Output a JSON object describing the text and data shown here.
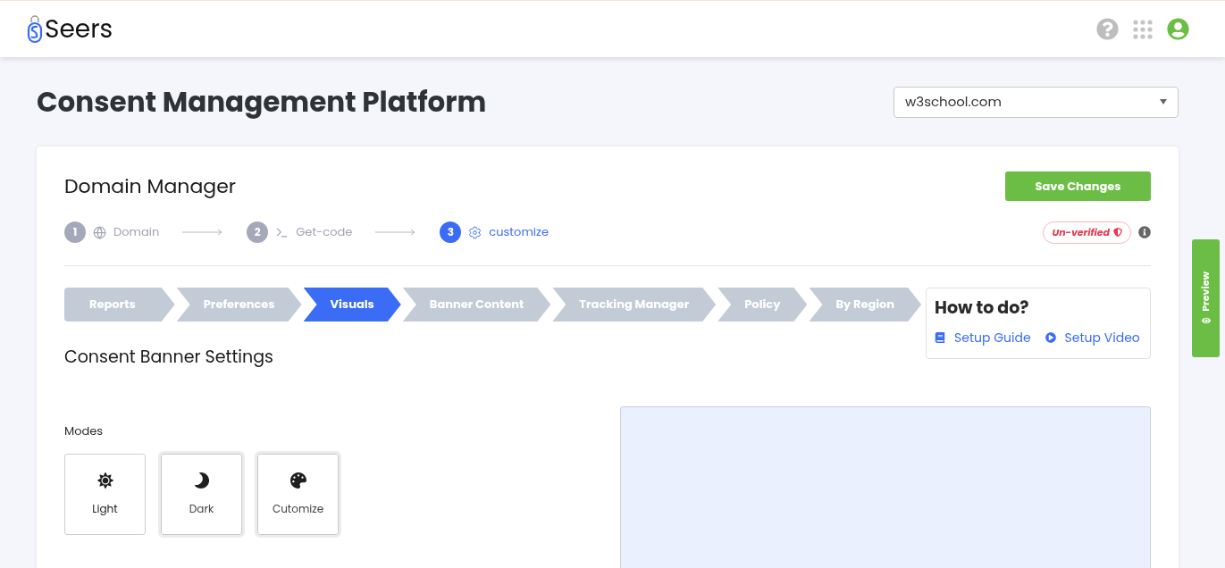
{
  "header": {
    "logo_text": "Seers"
  },
  "page_title": "Consent Management Platform",
  "domain_select": {
    "value": "w3school.com"
  },
  "card": {
    "title": "Domain Manager",
    "save_button": "Save Changes",
    "steps": [
      {
        "number": "1",
        "label": "Domain",
        "selected": false
      },
      {
        "number": "2",
        "label": "Get-code",
        "selected": false
      },
      {
        "number": "3",
        "label": "customize",
        "selected": true
      }
    ],
    "status_badge": "Un-verified",
    "tabs": [
      {
        "label": "Reports",
        "selected": false
      },
      {
        "label": "Preferences",
        "selected": false
      },
      {
        "label": "Visuals",
        "selected": true
      },
      {
        "label": "Banner Content",
        "selected": false
      },
      {
        "label": "Tracking Manager",
        "selected": false
      },
      {
        "label": "Policy",
        "selected": false
      },
      {
        "label": "By Region",
        "selected": false
      }
    ],
    "how_to": {
      "title": "How to do?",
      "links": [
        {
          "label": "Setup Guide",
          "kind": "guide"
        },
        {
          "label": "Setup Video",
          "kind": "video"
        }
      ]
    },
    "section_title": "Consent Banner Settings",
    "modes_label": "Modes",
    "modes": [
      {
        "label": "Light",
        "kind": "light",
        "selected": true
      },
      {
        "label": "Dark",
        "kind": "dark",
        "selected": false
      },
      {
        "label": "Cutomize",
        "kind": "palette",
        "selected": false
      }
    ]
  },
  "preview_tab": "Preview"
}
